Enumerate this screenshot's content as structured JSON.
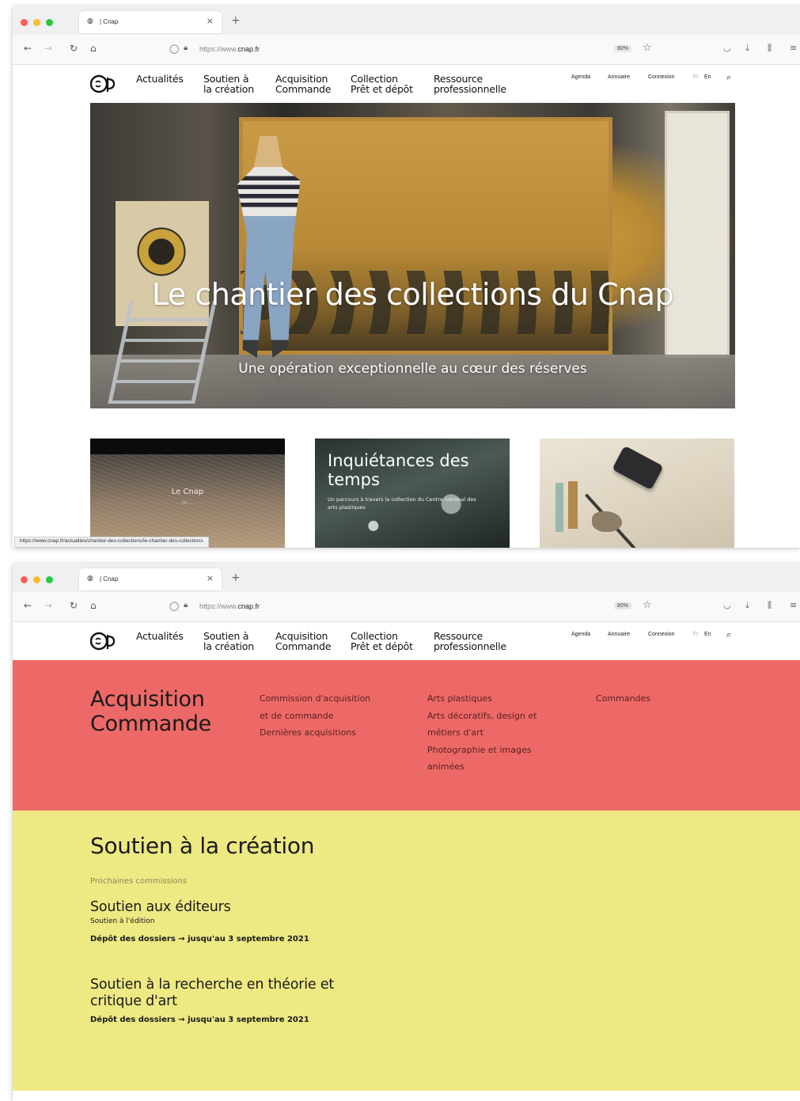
{
  "browser": {
    "tab_title": "| Cnap",
    "tab_close": "×",
    "new_tab": "+",
    "url_prefix": "https://www.",
    "url_domain": "cnap.fr",
    "zoom": "80%",
    "status_url": "https://www.cnap.fr/actualites/chantier-des-collections/le-chantier-des-collections",
    "traffic_lights": [
      "#fe5f57",
      "#febc2e",
      "#28c840"
    ]
  },
  "site_nav": {
    "menu": [
      {
        "label": "Actualités"
      },
      {
        "label": "Soutien à\nla création"
      },
      {
        "label": "Acquisition\nCommande"
      },
      {
        "label": "Collection\nPrêt et dépôt"
      },
      {
        "label": "Ressource\nprofessionnelle"
      }
    ],
    "utility": {
      "agenda": "Agenda",
      "annuaire": "Annuaire",
      "connexion": "Connexion",
      "lang_fr": "Fr",
      "lang_en": "En"
    }
  },
  "hero": {
    "title": "Le chantier des collections du Cnap",
    "subtitle": "Une opération exceptionnelle au cœur des réserves"
  },
  "cards": [
    {
      "title": "Le Cnap",
      "subtitle": "... de ... ..."
    },
    {
      "title": "Inquiétances des temps",
      "subtitle": "Un parcours à travers la collection du Centre national des arts plastiques"
    },
    {
      "title": ""
    }
  ],
  "mega_menu": {
    "title": "Acquisition Commande",
    "col1": [
      "Commission d'acquisition",
      "et de commande",
      "Dernières acquisitions"
    ],
    "col2": [
      "Arts plastiques",
      "Arts décoratifs, design et",
      "métiers d'art",
      "Photographie et images",
      "animées"
    ],
    "col3": [
      "Commandes"
    ]
  },
  "soutien": {
    "title": "Soutien à la création",
    "label": "Prochaines commissions",
    "items": [
      {
        "title": "Soutien aux éditeurs",
        "subtitle": "Soutien à l'édition",
        "deadline": "Dépôt des dossiers → jusqu'au 3 septembre 2021"
      },
      {
        "title": "Soutien à la recherche en théorie et\ncritique d'art",
        "subtitle": "",
        "deadline": "Dépôt des dossiers → jusqu'au 3 septembre 2021"
      }
    ]
  },
  "colors": {
    "mega_bg": "#ec6967",
    "soutien_bg": "#ede983"
  }
}
